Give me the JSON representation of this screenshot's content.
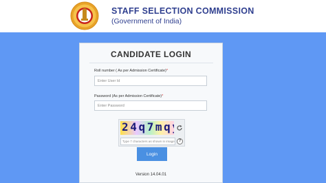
{
  "header": {
    "org_name": "STAFF SELECTION COMMISSION",
    "org_sub": "(Government of India)",
    "emblem_icon": "ssc-emblem"
  },
  "login": {
    "title": "CANDIDATE LOGIN",
    "roll_label": "Roll number ( As per Admission Certificate)",
    "roll_required": "*",
    "roll_placeholder": "Enter User Id",
    "roll_value": "",
    "password_label": "Password (As per Admission Certificate)",
    "password_required": "*",
    "password_placeholder": "Enter Password",
    "password_value": "",
    "captcha_text": "24q7mqy",
    "captcha_placeholder": "Type 7 characters as shown in image",
    "captcha_value": "",
    "help_label": "?",
    "button_label": "Login",
    "version": "Version 14.04.01"
  },
  "colors": {
    "background": "#5f98f4",
    "header_text": "#2f3f8f",
    "button": "#4a90e2",
    "required": "#d12b2b"
  }
}
